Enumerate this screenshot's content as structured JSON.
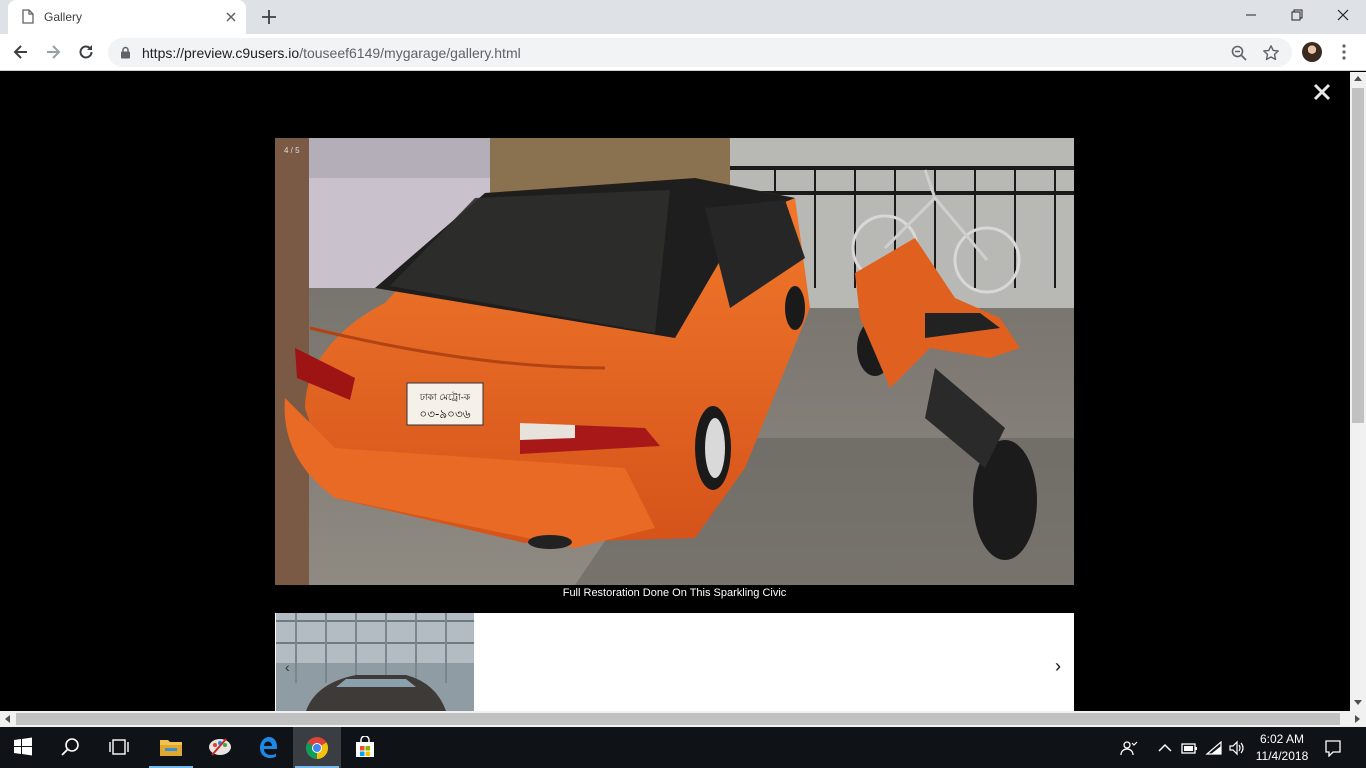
{
  "browser": {
    "tab_title": "Gallery",
    "url_host": "https://preview.c9users.io",
    "url_path": "/touseef6149/mygarage/gallery.html"
  },
  "lightbox": {
    "counter": "4 / 5",
    "caption": "Full Restoration Done On This Sparkling Civic",
    "close_glyph": "×",
    "prev_glyph": "‹",
    "next_glyph": "›",
    "plate_line1": "ঢাকা মেট্রো-ক",
    "plate_line2": "০৩-৯০৩৬"
  },
  "taskbar": {
    "time": "6:02 AM",
    "date": "11/4/2018"
  },
  "colors": {
    "accent": "#76b9ed",
    "car": "#e8641c",
    "page_bg": "#000000"
  }
}
